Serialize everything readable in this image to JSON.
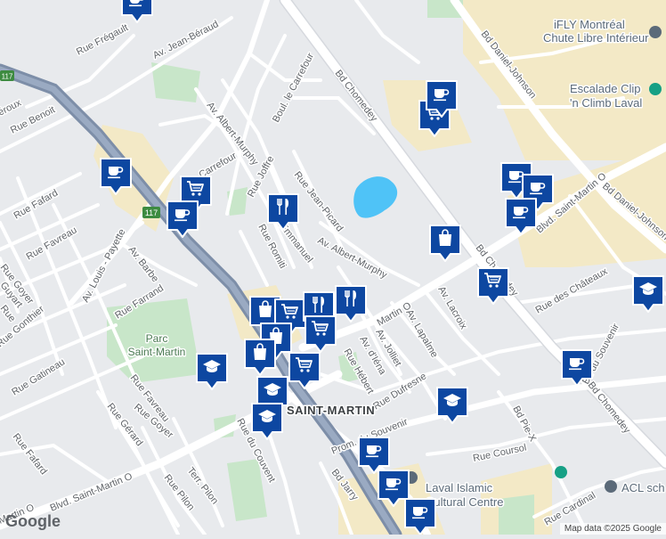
{
  "map": {
    "attribution": "Map data ©2025 Google",
    "logo": "Google",
    "colors": {
      "background": "#e8eaed",
      "road": "#ffffff",
      "major_road": "#ffffff",
      "highway": "#8a9bb4",
      "railway": "#5f708c",
      "park": "#c8e6c9",
      "commercial": "#f3e9c6",
      "water": "#4fc3f7",
      "marker": "#0d47a1"
    },
    "labels": {
      "rue_fregault": "Rue Frégault",
      "av_jean_beraud": "Av. Jean-Béraud",
      "rue_benoit": "Rue Benoit",
      "av_albert_murphy_n": "Av. Albert-Murphy",
      "boul_le_carrefour": "Boul. le Carrefour",
      "carrefour": "Carrefour",
      "bd_chomedey_n": "Bd Chomedey",
      "bd_daniel_johnson_n": "Bd Daniel-Johnson",
      "rue_fafard_n": "Rue Fafard",
      "rue_favreau_n": "Rue Favreau",
      "av_louis_payette": "Av. Louis - Payette",
      "av_barbe": "Av. Barbe",
      "rue_goyer": "Rue Goyer",
      "guyart": "Guyart",
      "rue_gonthier": "Rue Gonthier",
      "rue_farrand": "Rue Farrand",
      "rue_gatineau": "Rue Gatineau",
      "rue_joffre": "Rue Joffre",
      "rue_jean_picard": "Rue Jean-Picard",
      "emmanuel": "Emmanuel",
      "rue_romiti": "Rue Romiti",
      "av_albert_murphy_s": "Av. Albert-Murphy",
      "blvd_saint_martin_o_ne": "Blvd. Saint-Martin O",
      "bd_daniel_johnson_s": "Bd Daniel-Johnson",
      "bd_chomedey_mid": "Bd Chomedey",
      "av_lacroix": "Av. Lacroix",
      "rue_des_chateaux": "Rue des Châteaux",
      "martin_o": "Martin O",
      "av_lapalme": "Av. Lapalme",
      "av_jolliet": "Av. Jolliet",
      "av_dieppe": "Av. d'Iéna",
      "rue_hebert": "Rue Hébert",
      "rue_dufresne": "Rue Dufresne",
      "bd_du_souvenir_e": "Bd du Souvenir",
      "bd_chomedey_s": "Bd Chomedey",
      "rue_favreau_s": "Rue Favreau",
      "rue_goyer_s": "Rue Goyer",
      "rue_gerard": "Rue Gérard",
      "rue_fafard_s": "Rue Fafard",
      "blvd_saint_martin_o_sw": "Blvd. Saint-Martin O",
      "martin_o_w": "Martin O",
      "rue_du_couvent": "Rue du Couvent",
      "rue_pilon": "Rue Pilon",
      "terr_pilon": "Terr. Pilon",
      "bd_jarry": "Bd Jarry",
      "prom_du_souvenir": "Prom. du Souvenir",
      "rue_coursol": "Rue Coursol",
      "bd_pie_x": "Bd Pie-X",
      "rue_cardinal": "Rue Cardinal",
      "rue_generic": "Rue",
      "eroux": "éroux",
      "saint_martin": "SAINT-MARTIN",
      "hwy_117_a": "117",
      "hwy_117_b": "117"
    },
    "pois": {
      "ifly_line1": "iFLY Montréal",
      "ifly_line2": "Chute Libre Intérieur",
      "escalade_line1": "Escalade Clip",
      "escalade_line2": "'n Climb Laval",
      "laval_islamic_line1": "Laval Islamic",
      "laval_islamic_line2": "Cultural Centre",
      "acl": "ACL sch",
      "parc_line1": "Parc",
      "parc_line2": "Saint-Martin"
    },
    "markers": [
      {
        "type": "coffee-icon"
      },
      {
        "type": "coffee-icon"
      },
      {
        "type": "cart-icon"
      },
      {
        "type": "coffee-icon"
      },
      {
        "type": "cart-icon"
      },
      {
        "type": "restaurant-icon"
      },
      {
        "type": "coffee-icon"
      },
      {
        "type": "coffee-icon"
      },
      {
        "type": "coffee-icon"
      },
      {
        "type": "coffee-icon"
      },
      {
        "type": "shopping-bag-icon"
      },
      {
        "type": "cart-icon"
      },
      {
        "type": "school-icon"
      },
      {
        "type": "shopping-bag-icon"
      },
      {
        "type": "cart-icon"
      },
      {
        "type": "restaurant-icon"
      },
      {
        "type": "restaurant-icon"
      },
      {
        "type": "shopping-bag-icon"
      },
      {
        "type": "cart-icon"
      },
      {
        "type": "shopping-bag-icon"
      },
      {
        "type": "cart-icon"
      },
      {
        "type": "school-icon"
      },
      {
        "type": "school-icon"
      },
      {
        "type": "school-icon"
      },
      {
        "type": "school-icon"
      },
      {
        "type": "coffee-icon"
      },
      {
        "type": "coffee-icon"
      },
      {
        "type": "coffee-icon"
      },
      {
        "type": "coffee-icon"
      }
    ]
  }
}
